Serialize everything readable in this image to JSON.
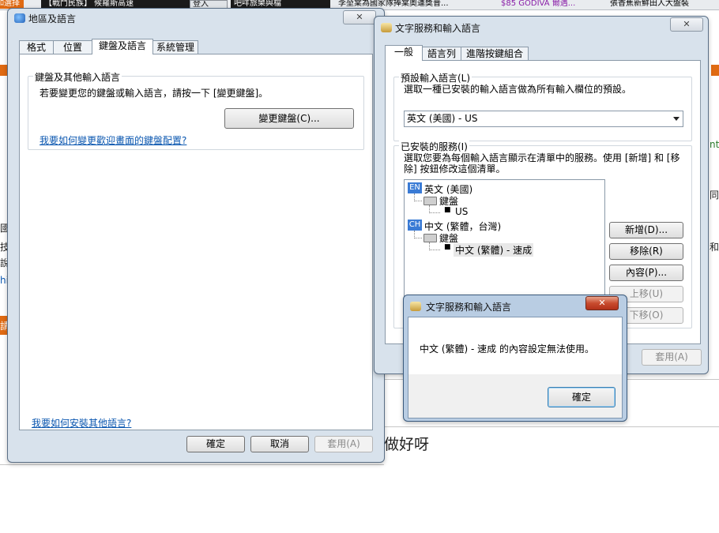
{
  "background": {
    "topbar_items": [
      "ﾛ選择",
      "【戰鬥民族】 候羅斯高速",
      "登入",
      "吧咩旅樂與檔",
      "李堃棠為國家隊捧棠奧運獎普...",
      "$85 GODIVA 爾遇...",
      "張香蕉新鮮田人大盤裝"
    ],
    "side_fragments": [
      "國",
      "技",
      "說",
      "hi",
      "請",
      "nt",
      "同",
      "和"
    ],
    "bottom_text": "做好呀"
  },
  "region_window": {
    "title": "地區及語言",
    "close": "✕",
    "tabs": [
      "格式",
      "位置",
      "鍵盤及語言",
      "系統管理"
    ],
    "group_title": "鍵盤及其他輸入語言",
    "description": "若要變更您的鍵盤或輸入語言，請按一下 [變更鍵盤]。",
    "change_keyboard_button": "變更鍵盤(C)...",
    "link_welcome": "我要如何變更歡迎畫面的鍵盤配置?",
    "link_install": "我要如何安裝其他語言?",
    "ok": "確定",
    "cancel": "取消",
    "apply": "套用(A)"
  },
  "text_services_window": {
    "title": "文字服務和輸入語言",
    "close": "✕",
    "tabs": [
      "一般",
      "語言列",
      "進階按鍵組合"
    ],
    "default_group_title": "預設輸入語言(L)",
    "default_desc": "選取一種已安裝的輸入語言做為所有輸入欄位的預設。",
    "default_value": "英文 (美國) - US",
    "installed_group_title": "已安裝的服務(I)",
    "installed_desc_1": "選取您要為每個輸入語言顯示在清單中的服務。使用 [新增] 和 [移",
    "installed_desc_2": "除] 按鈕修改這個清單。",
    "tree": {
      "en_code": "EN",
      "en_label": "英文 (美國)",
      "en_keyboard": "鍵盤",
      "en_layout": "US",
      "ch_code": "CH",
      "ch_label": "中文 (繁體，台灣)",
      "ch_keyboard": "鍵盤",
      "ch_layout": "中文 (繁體) - 速成"
    },
    "add": "新增(D)...",
    "remove": "移除(R)",
    "properties": "內容(P)...",
    "move_up": "上移(U)",
    "move_down": "下移(O)",
    "apply": "套用(A)"
  },
  "message_dialog": {
    "title": "文字服務和輸入語言",
    "close": "✕",
    "message": "中文 (繁體) - 速成 的內容設定無法使用。",
    "ok": "確定"
  },
  "colors": {
    "accent_orange": "#e06a12",
    "link_blue": "#0b57b0",
    "lang_badge": "#3a7bd5"
  }
}
